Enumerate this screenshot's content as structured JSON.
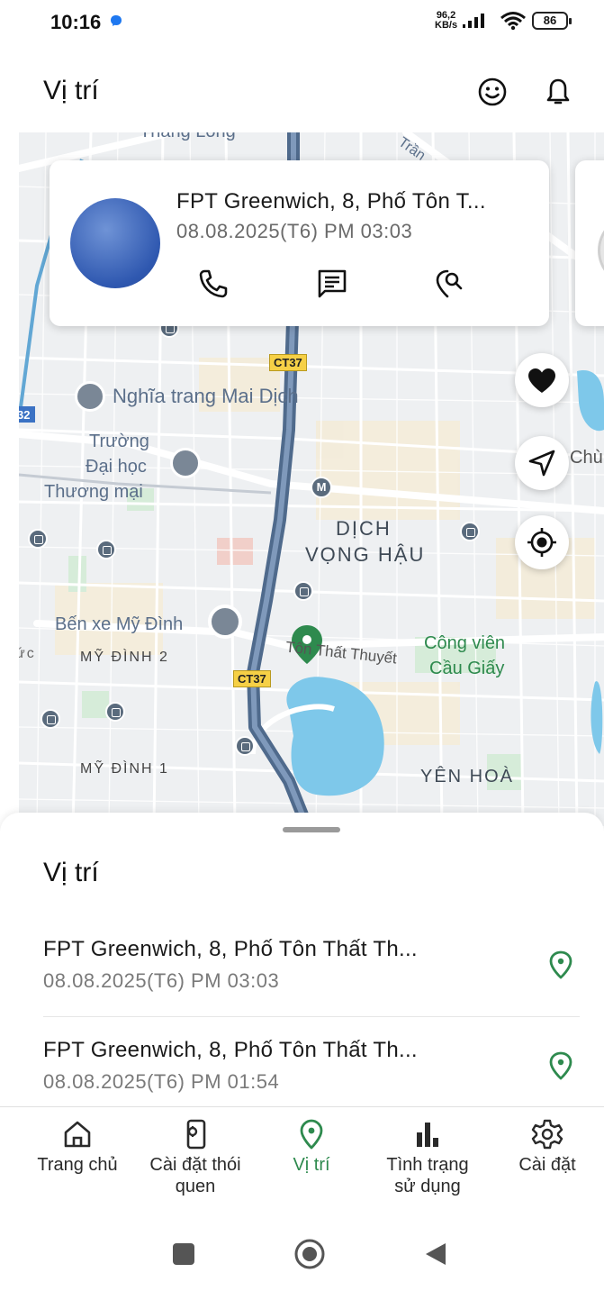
{
  "status_bar": {
    "time": "10:16",
    "net_speed_value": "96,2",
    "net_speed_unit": "KB/s",
    "battery": "86"
  },
  "header": {
    "title": "Vị trí",
    "icons": [
      "smiley-icon",
      "bell-icon"
    ]
  },
  "map": {
    "labels": {
      "thang_long": "Thang Long",
      "tran": "Trần",
      "nghia_trang": "Nghĩa trang Mai Dịch",
      "truong_line1": "Trường",
      "truong_line2": "Đại học",
      "truong_line3": "Thương mại",
      "dich_vong_line1": "DỊCH",
      "dich_vong_line2": "VỌNG HẬU",
      "ben_xe": "Bến xe Mỹ Đình",
      "my_dinh_2": "MỸ ĐÌNH 2",
      "ton_that_thuyet": "Tôn Thất Thuyết",
      "cong_vien_line1": "Công viên",
      "cong_vien_line2": "Cầu Giấy",
      "my_dinh_1": "MỸ ĐÌNH 1",
      "yen_hoa": "YÊN HOÀ",
      "chu": "Chù",
      "route_32": "32",
      "ct37_a": "CT37",
      "ct37_b": "CT37",
      "metro": "M",
      "uc": "ức"
    }
  },
  "location_card": {
    "address": "FPT Greenwich, 8, Phố Tôn T...",
    "time": "08.08.2025(T6) PM 03:03",
    "actions": [
      "phone-icon",
      "message-icon",
      "location-search-icon"
    ]
  },
  "map_buttons": [
    "heart-icon",
    "navigation-arrow-icon",
    "my-location-icon"
  ],
  "sheet": {
    "title": "Vị trí",
    "items": [
      {
        "address": "FPT Greenwich, 8, Phố Tôn Thất Th...",
        "time": "08.08.2025(T6) PM 03:03"
      },
      {
        "address": "FPT Greenwich, 8, Phố Tôn Thất Th...",
        "time": "08.08.2025(T6) PM 01:54"
      }
    ]
  },
  "nav": {
    "items": [
      {
        "label": "Trang chủ",
        "icon": "home-icon"
      },
      {
        "label_line1": "Cài đặt thói",
        "label_line2": "quen",
        "icon": "phone-settings-icon"
      },
      {
        "label": "Vị trí",
        "icon": "location-pin-icon"
      },
      {
        "label_line1": "Tình trạng",
        "label_line2": "sử dụng",
        "icon": "bar-chart-icon"
      },
      {
        "label": "Cài đặt",
        "icon": "gear-icon"
      }
    ]
  },
  "colors": {
    "accent_green": "#2e8a4e",
    "map_road_major": "#5a7191",
    "map_water": "#7ec8ea",
    "avatar_blue": "#2f58b0"
  }
}
